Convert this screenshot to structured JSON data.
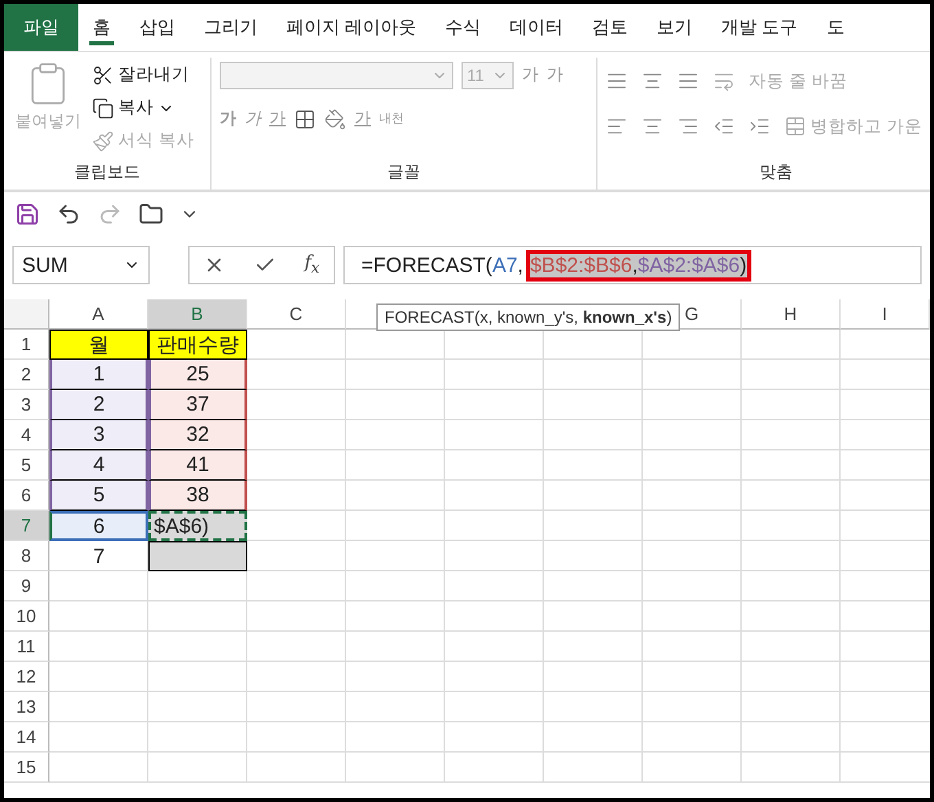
{
  "tabs": [
    {
      "label": "파일",
      "kind": "file",
      "selected": false
    },
    {
      "label": "홈",
      "kind": "tab",
      "selected": true
    },
    {
      "label": "삽입",
      "kind": "tab",
      "selected": false
    },
    {
      "label": "그리기",
      "kind": "tab",
      "selected": false
    },
    {
      "label": "페이지 레이아웃",
      "kind": "tab",
      "selected": false
    },
    {
      "label": "수식",
      "kind": "tab",
      "selected": false
    },
    {
      "label": "데이터",
      "kind": "tab",
      "selected": false
    },
    {
      "label": "검토",
      "kind": "tab",
      "selected": false
    },
    {
      "label": "보기",
      "kind": "tab",
      "selected": false
    },
    {
      "label": "개발 도구",
      "kind": "tab",
      "selected": false
    },
    {
      "label": "도",
      "kind": "tab",
      "selected": false
    }
  ],
  "ribbon": {
    "clipboard": {
      "paste": "붙여넣기",
      "cut": "잘라내기",
      "copy": "복사",
      "format_painter": "서식 복사",
      "label": "클립보드"
    },
    "font": {
      "size": "11",
      "grow": "가",
      "shrink": "가",
      "bold": "가",
      "italic": "가",
      "underline": "가",
      "font_color": "가",
      "phonetic": "내천",
      "label": "글꼴"
    },
    "alignment": {
      "wrap": "자동 줄 바꿈",
      "merge": "병합하고 가운",
      "label": "맞춤"
    }
  },
  "name_box": {
    "value": "SUM"
  },
  "insert_function": "f$_{x}$",
  "formula": {
    "parts": [
      {
        "text": "=FORECAST(",
        "kind": "plain"
      },
      {
        "text": "A7",
        "kind": "ref",
        "color": "#3c6fb8"
      },
      {
        "text": ",",
        "kind": "plain"
      },
      {
        "text": "$B$2:$B$6",
        "kind": "ref",
        "color": "#c0504d",
        "highlighted": true
      },
      {
        "text": ",",
        "kind": "plain",
        "highlighted": true
      },
      {
        "text": "$A$2:$A$6",
        "kind": "ref",
        "color": "#8064a2",
        "highlighted": true
      },
      {
        "text": ")",
        "kind": "plain",
        "highlighted": true
      }
    ]
  },
  "columns": [
    {
      "kind": "column",
      "label": "A",
      "selected": false
    },
    {
      "kind": "column",
      "label": "B",
      "selected": true
    },
    {
      "kind": "column",
      "label": "C",
      "selected": false
    },
    {
      "kind": "tooltip",
      "text": "FORECAST(x, known_y's, **known_x's**)"
    },
    {
      "kind": "column",
      "label": "G",
      "selected": false
    },
    {
      "kind": "column",
      "label": "H",
      "selected": false
    },
    {
      "kind": "column",
      "label": "I",
      "selected": false
    }
  ],
  "rows": [
    {
      "number": "1",
      "selected": false,
      "cells": [
        {
          "value": "월",
          "kind": "header"
        },
        {
          "value": "판매수량",
          "kind": "header"
        }
      ]
    },
    {
      "number": "2",
      "selected": false,
      "cells": [
        {
          "value": "1",
          "kind": "x_range"
        },
        {
          "value": "25",
          "kind": "y_range"
        }
      ]
    },
    {
      "number": "3",
      "selected": false,
      "cells": [
        {
          "value": "2",
          "kind": "x_range"
        },
        {
          "value": "37",
          "kind": "y_range"
        }
      ]
    },
    {
      "number": "4",
      "selected": false,
      "cells": [
        {
          "value": "3",
          "kind": "x_range"
        },
        {
          "value": "32",
          "kind": "y_range"
        }
      ]
    },
    {
      "number": "5",
      "selected": false,
      "cells": [
        {
          "value": "4",
          "kind": "x_range"
        },
        {
          "value": "41",
          "kind": "y_range"
        }
      ]
    },
    {
      "number": "6",
      "selected": false,
      "cells": [
        {
          "value": "5",
          "kind": "x_range"
        },
        {
          "value": "38",
          "kind": "y_range"
        }
      ]
    },
    {
      "number": "7",
      "selected": true,
      "cells": [
        {
          "value": "6",
          "kind": "x_ref"
        },
        {
          "value": "$A$6)",
          "kind": "editing"
        }
      ]
    },
    {
      "number": "8",
      "selected": false,
      "cells": [
        {
          "value": "7",
          "kind": "plain"
        },
        {
          "kind": "selected"
        }
      ]
    },
    {
      "number": "9",
      "selected": false,
      "cells": []
    },
    {
      "number": "10",
      "selected": false,
      "cells": []
    },
    {
      "number": "11",
      "selected": false,
      "cells": []
    },
    {
      "number": "12",
      "selected": false,
      "cells": []
    },
    {
      "number": "13",
      "selected": false,
      "cells": []
    },
    {
      "number": "14",
      "selected": false,
      "cells": []
    },
    {
      "number": "15",
      "selected": false,
      "cells": []
    }
  ]
}
